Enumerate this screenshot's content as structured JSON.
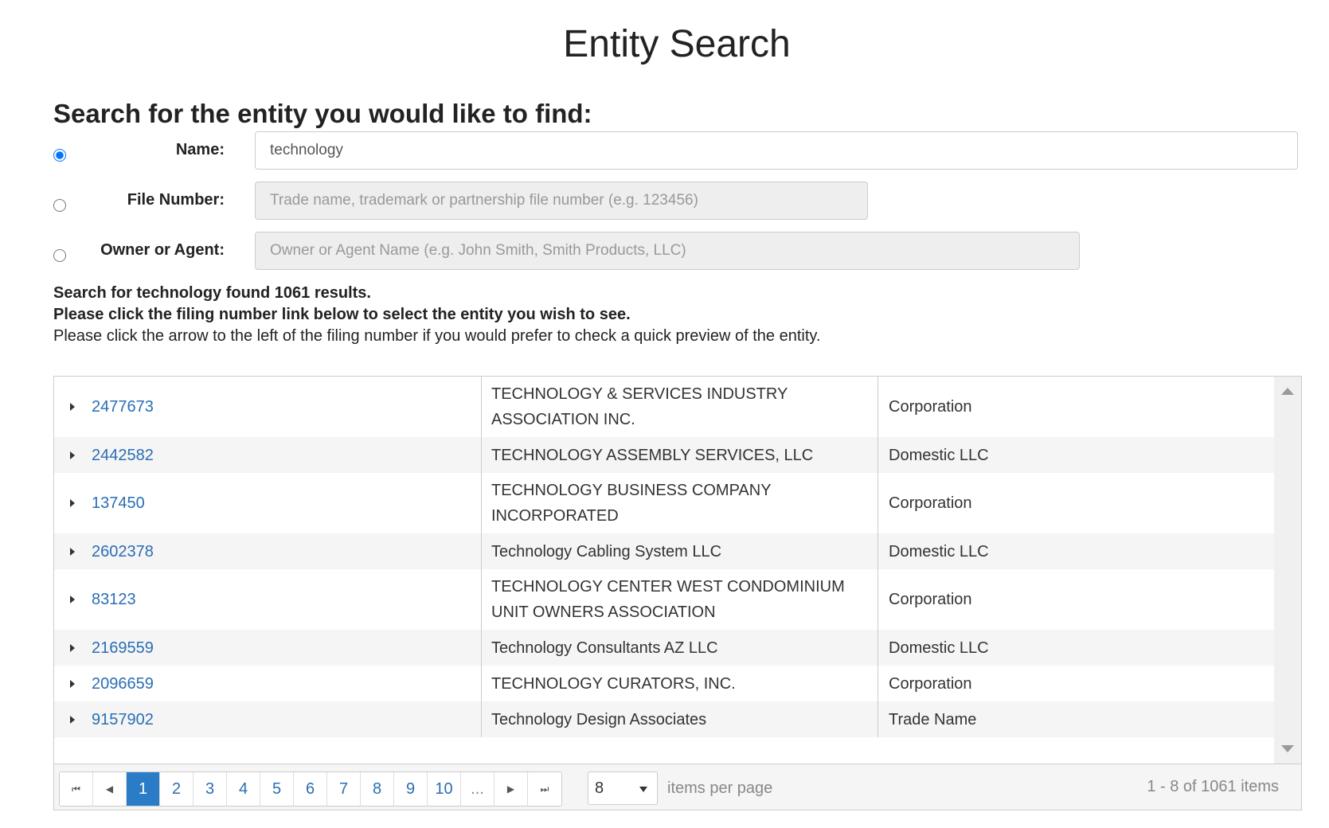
{
  "page": {
    "title": "Entity Search"
  },
  "search": {
    "heading": "Search for the entity you would like to find:",
    "name": {
      "label": "Name:",
      "value": "technology"
    },
    "file_number": {
      "label": "File Number:",
      "placeholder": "Trade name, trademark or partnership file number (e.g. 123456)"
    },
    "owner_agent": {
      "label": "Owner or Agent:",
      "placeholder": "Owner or Agent Name (e.g. John Smith, Smith Products, LLC)"
    }
  },
  "results": {
    "summary": "Search for technology found 1061 results.",
    "instruction_bold": "Please click the filing number link below to select the entity you wish to see.",
    "instruction": "Please click the arrow to the left of the filing number if you would prefer to check a quick preview of the entity."
  },
  "table": {
    "rows": [
      {
        "file_number": "2477673",
        "name": "TECHNOLOGY & SERVICES INDUSTRY ASSOCIATION INC.",
        "type": "Corporation"
      },
      {
        "file_number": "2442582",
        "name": "TECHNOLOGY ASSEMBLY SERVICES, LLC",
        "type": "Domestic LLC"
      },
      {
        "file_number": "137450",
        "name": "TECHNOLOGY BUSINESS COMPANY INCORPORATED",
        "type": "Corporation"
      },
      {
        "file_number": "2602378",
        "name": "Technology Cabling System LLC",
        "type": "Domestic LLC"
      },
      {
        "file_number": "83123",
        "name": "TECHNOLOGY CENTER WEST CONDOMINIUM UNIT OWNERS ASSOCIATION",
        "type": "Corporation"
      },
      {
        "file_number": "2169559",
        "name": "Technology Consultants AZ LLC",
        "type": "Domestic LLC"
      },
      {
        "file_number": "2096659",
        "name": "TECHNOLOGY CURATORS, INC.",
        "type": "Corporation"
      },
      {
        "file_number": "9157902",
        "name": "Technology Design Associates",
        "type": "Trade Name"
      }
    ]
  },
  "pager": {
    "first_icon": "first-page-icon",
    "prev_icon": "previous-page-icon",
    "next_icon": "next-page-icon",
    "last_icon": "last-page-icon",
    "pages": [
      "1",
      "2",
      "3",
      "4",
      "5",
      "6",
      "7",
      "8",
      "9",
      "10"
    ],
    "current_page": "1",
    "ellipsis": "...",
    "per_page_value": "8",
    "per_page_label": "items per page",
    "items_info": "1 - 8 of 1061 items"
  },
  "colors": {
    "link": "#2a6eb5",
    "active_page": "#2a7cc7",
    "alt_row": "#f5f5f5"
  }
}
